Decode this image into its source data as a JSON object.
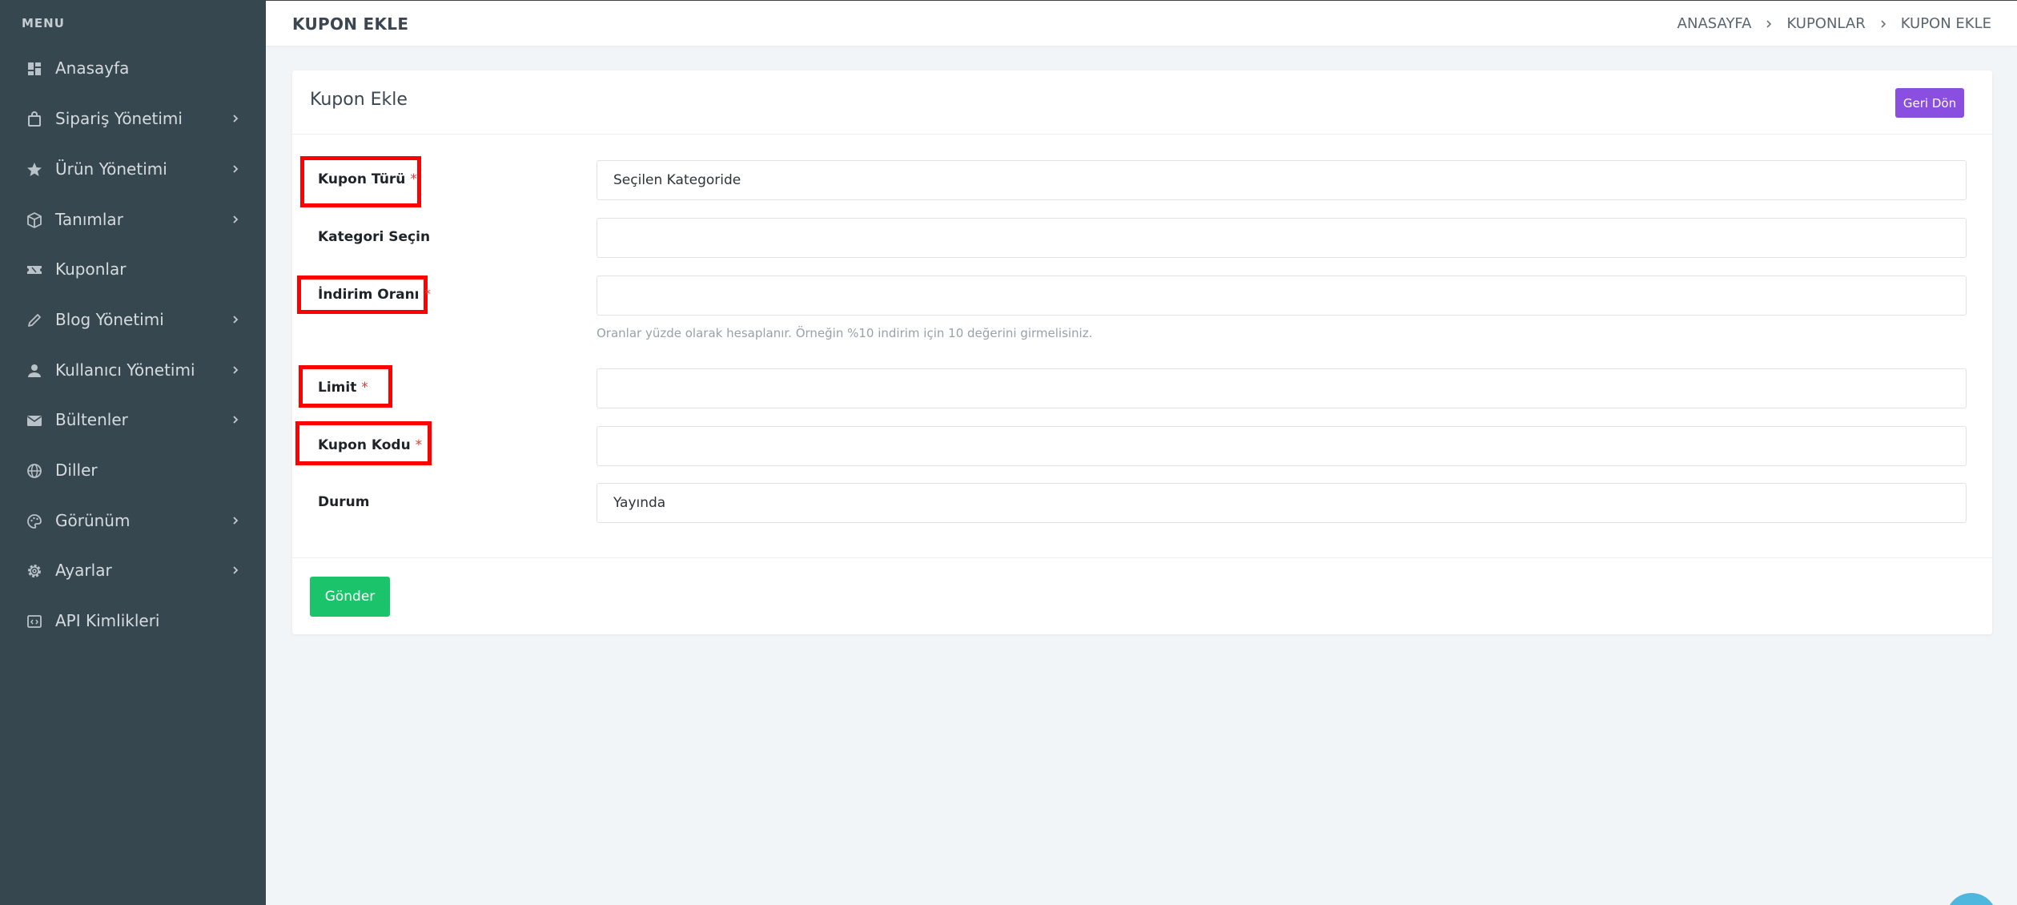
{
  "sidebar": {
    "title": "MENU",
    "items": [
      {
        "label": "Anasayfa",
        "icon": "dashboard-icon",
        "has_submenu": false
      },
      {
        "label": "Sipariş Yönetimi",
        "icon": "shopping-bag-icon",
        "has_submenu": true
      },
      {
        "label": "Ürün Yönetimi",
        "icon": "star-icon",
        "has_submenu": true
      },
      {
        "label": "Tanımlar",
        "icon": "box-icon",
        "has_submenu": true
      },
      {
        "label": "Kuponlar",
        "icon": "ticket-icon",
        "has_submenu": false
      },
      {
        "label": "Blog Yönetimi",
        "icon": "pencil-icon",
        "has_submenu": true
      },
      {
        "label": "Kullanıcı Yönetimi",
        "icon": "user-icon",
        "has_submenu": true
      },
      {
        "label": "Bültenler",
        "icon": "mail-icon",
        "has_submenu": true
      },
      {
        "label": "Diller",
        "icon": "globe-icon",
        "has_submenu": false
      },
      {
        "label": "Görünüm",
        "icon": "palette-icon",
        "has_submenu": true
      },
      {
        "label": "Ayarlar",
        "icon": "gear-icon",
        "has_submenu": true
      },
      {
        "label": "API Kimlikleri",
        "icon": "code-window-icon",
        "has_submenu": false
      }
    ]
  },
  "header": {
    "title": "KUPON EKLE",
    "breadcrumb": [
      "ANASAYFA",
      "KUPONLAR",
      "KUPON EKLE"
    ]
  },
  "card": {
    "title": "Kupon Ekle",
    "back_label": "Geri Dön",
    "submit_label": "Gönder"
  },
  "form": {
    "coupon_type": {
      "label": "Kupon Türü",
      "required_mark": "*",
      "value": "Seçilen Kategoride"
    },
    "category": {
      "label": "Kategori Seçin",
      "value": ""
    },
    "discount_rate": {
      "label": "İndirim Oranı",
      "required_mark": "*",
      "value": "",
      "help": "Oranlar yüzde olarak hesaplanır. Örneğin %10 indirim için 10 değerini girmelisiniz."
    },
    "limit": {
      "label": "Limit",
      "required_mark": "*",
      "value": ""
    },
    "coupon_code": {
      "label": "Kupon Kodu",
      "required_mark": "*",
      "value": ""
    },
    "status": {
      "label": "Durum",
      "value": "Yayında"
    }
  },
  "colors": {
    "sidebar_bg": "#37474f",
    "back_button": "#8a4fe0",
    "submit_button": "#1bc46a",
    "required": "#e53935",
    "highlight": "#ff0000"
  }
}
